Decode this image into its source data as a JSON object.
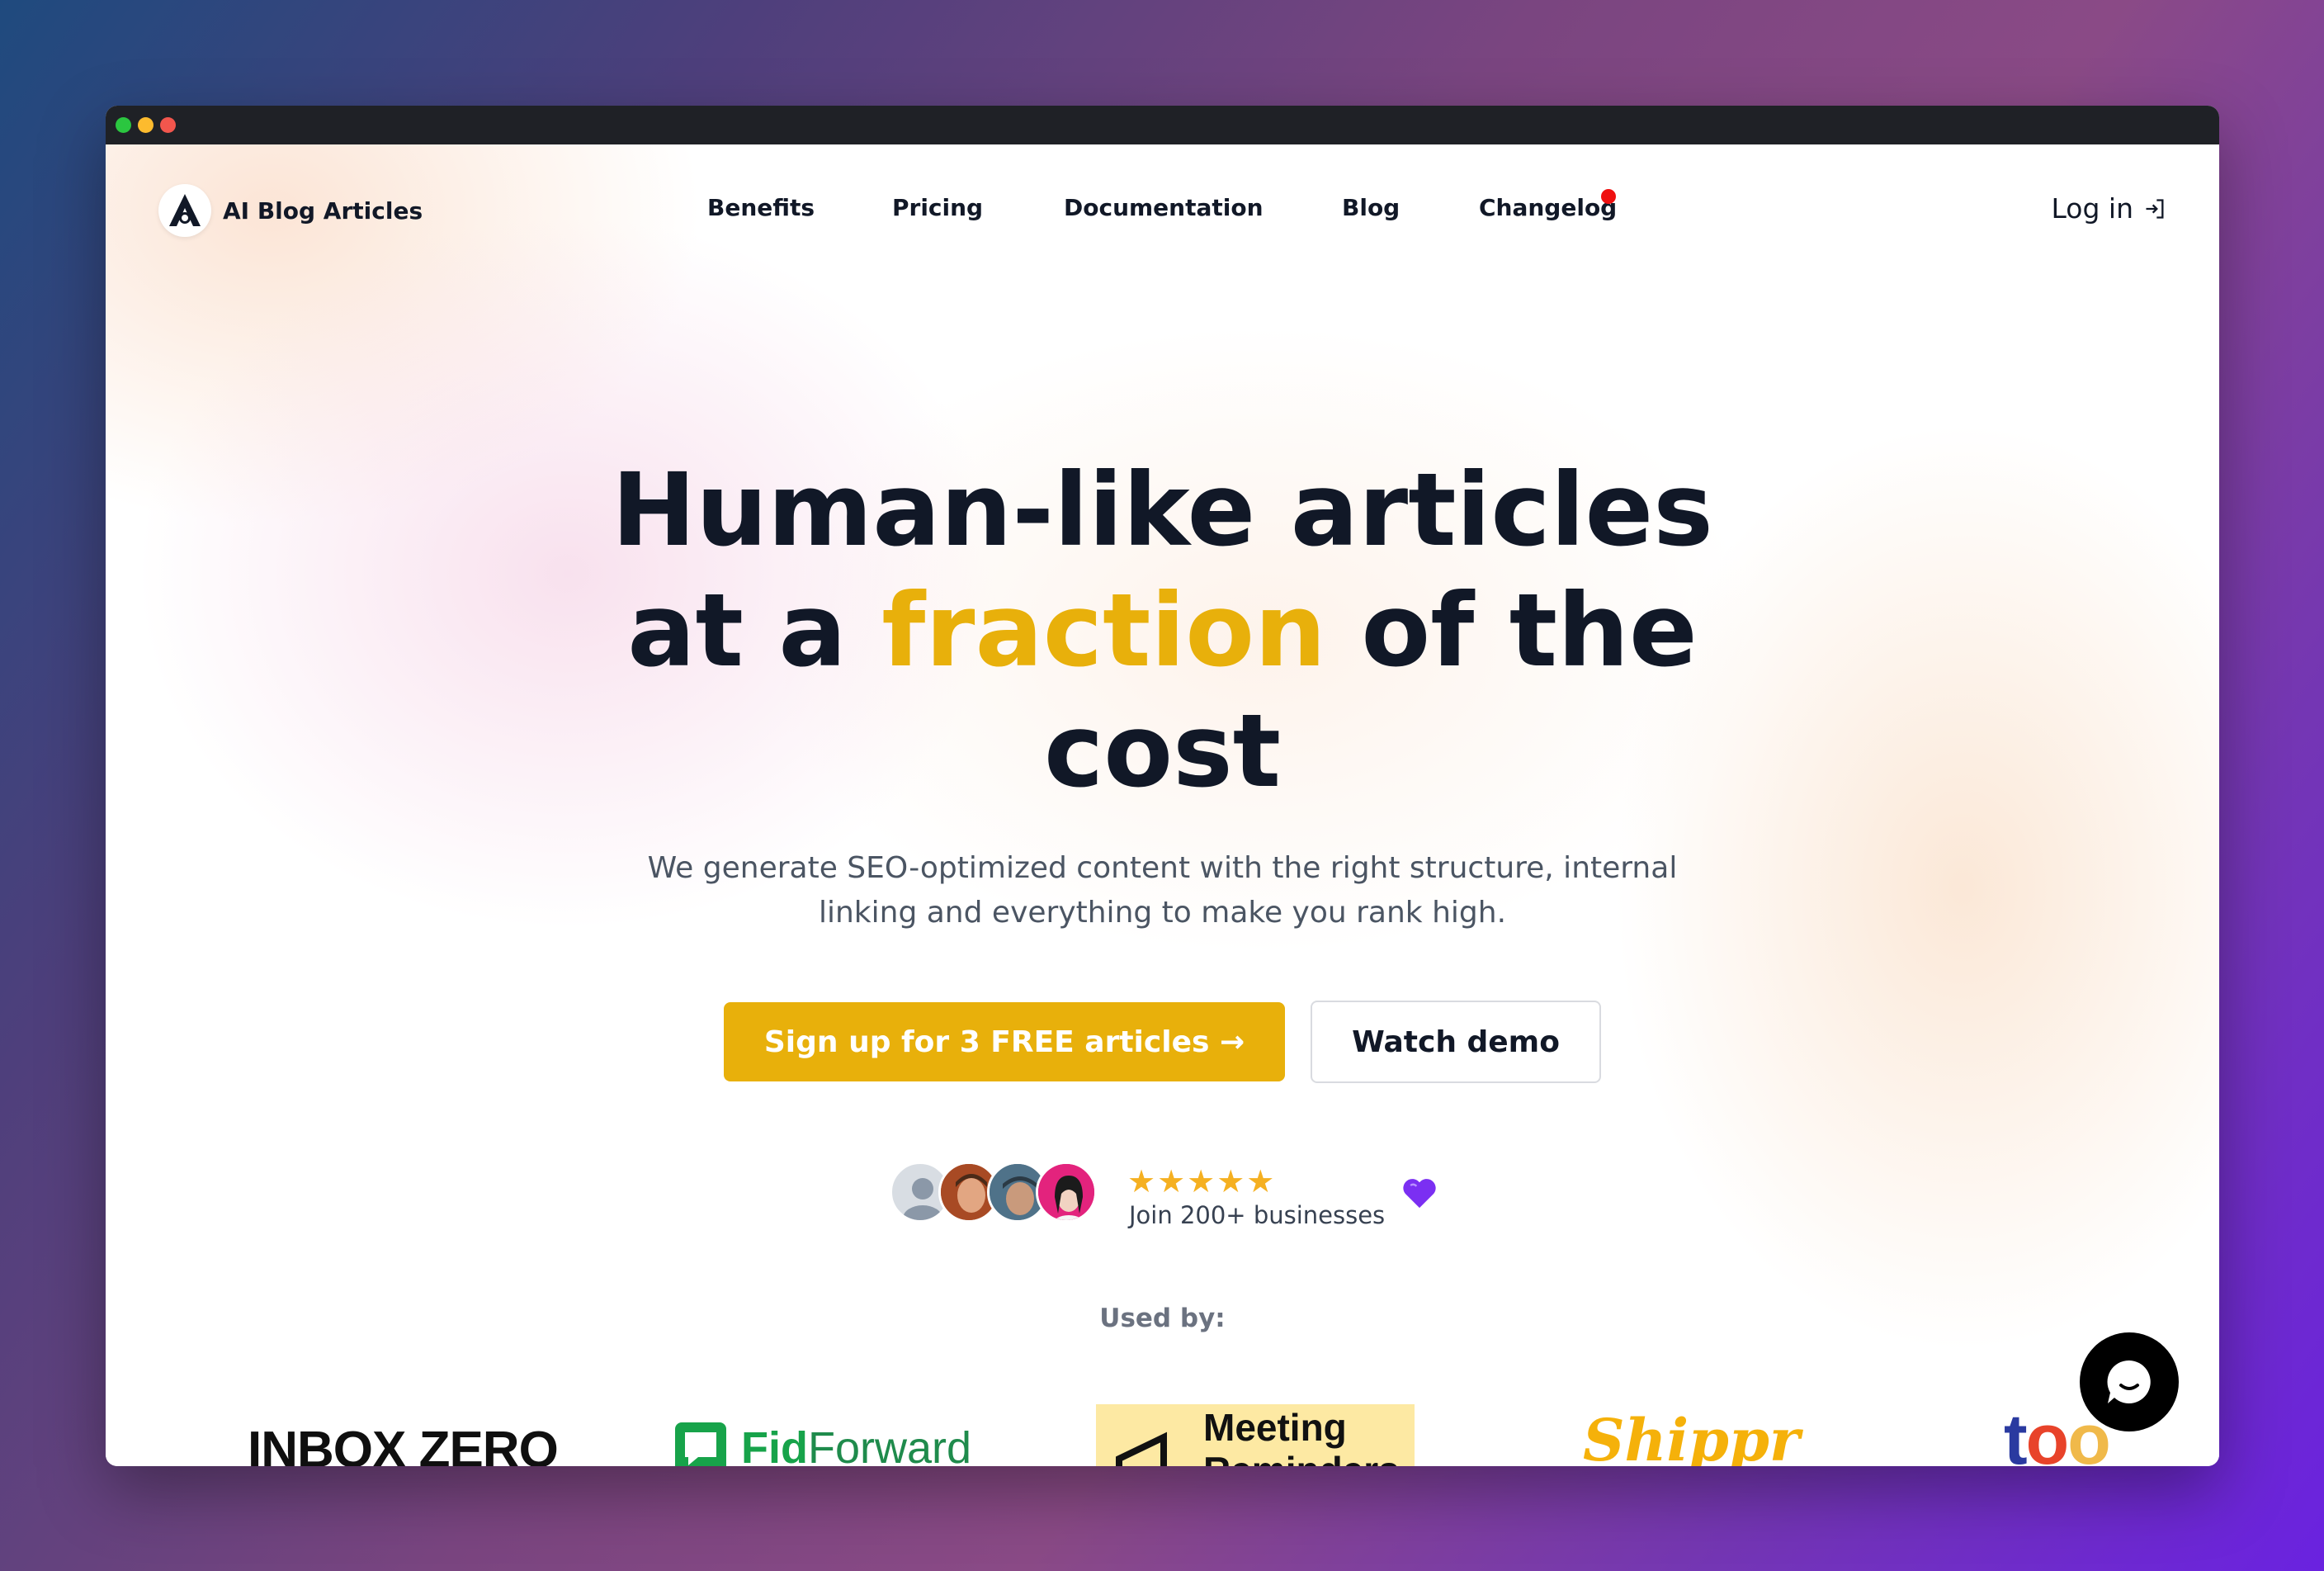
{
  "brand": {
    "name": "AI Blog Articles",
    "icon": "logo-a-icon"
  },
  "nav": {
    "items": [
      {
        "label": "Benefits"
      },
      {
        "label": "Pricing"
      },
      {
        "label": "Documentation"
      },
      {
        "label": "Blog"
      },
      {
        "label": "Changelog",
        "has_badge": true
      }
    ],
    "login_label": "Log in",
    "login_icon": "login-arrow-icon"
  },
  "hero": {
    "title_line1": "Human-like articles",
    "title_line2_pre": "at a",
    "title_line2_accent": "fraction",
    "title_line2_post": "of the",
    "title_line3": "cost",
    "subtitle_line1": "We generate SEO-optimized content with the right structure, internal",
    "subtitle_line2": "linking and everything to make you rank high.",
    "primary_cta": "Sign up for 3 FREE articles →",
    "secondary_cta": "Watch demo"
  },
  "social_proof": {
    "rating_stars": 5,
    "stars_text": "★★★★★",
    "join_text": "Join 200+ businesses",
    "heart_icon": "purple-heart-icon"
  },
  "used_by": {
    "label": "Used by:",
    "logos": [
      {
        "name": "INBOX ZERO"
      },
      {
        "name_bold": "Fid",
        "name_rest": "Forward"
      },
      {
        "name": "Meeting Reminders"
      },
      {
        "name": "Shippr"
      },
      {
        "name": "too"
      }
    ]
  },
  "colors": {
    "accent": "#e8b00b",
    "text": "#111827",
    "muted": "#4b5563",
    "badge": "#ef1010"
  },
  "chat_widget": {
    "icon": "chat-bubble-icon"
  }
}
